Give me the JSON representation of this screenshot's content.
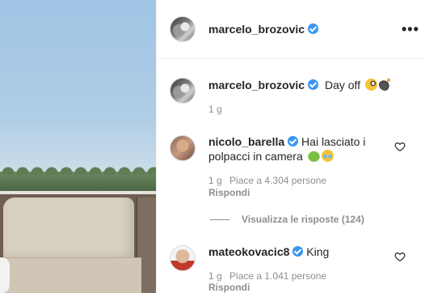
{
  "post": {
    "author": "marcelo_brozovic"
  },
  "caption": {
    "author": "marcelo_brozovic",
    "text": "Day off",
    "emojis": [
      "face-with-monocle",
      "bomb"
    ],
    "time": "1 g"
  },
  "comments": [
    {
      "author": "nicolo_barella",
      "text_line1": "Hai lasciato i",
      "text_line2": "polpacci in camera",
      "emojis": [
        "nauseated-face",
        "face-with-tears-of-joy"
      ],
      "time": "1 g",
      "likes": "Piace a 4.304 persone",
      "reply": "Rispondi",
      "view_replies": "Visualizza le risposte (124)"
    },
    {
      "author": "mateokovacic8",
      "text": "King",
      "time": "1 g",
      "likes": "Piace a 1.041 persone",
      "reply": "Rispondi"
    }
  ],
  "colors": {
    "verified": "#3897f0",
    "text": "#262626",
    "meta": "#8e8e8e",
    "divider": "#efefef"
  }
}
